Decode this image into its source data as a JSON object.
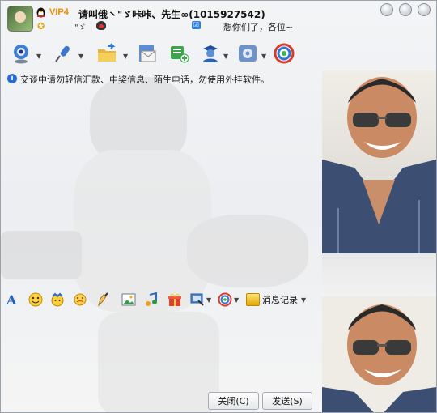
{
  "title": {
    "vip": "VIP4",
    "contact_name": "请叫俄丶\"ゞ咔咔、先生∞(1015927542)",
    "line2": "\"ゞ",
    "signature": "想你们了，各位~"
  },
  "toolbar": {
    "items": [
      "video-call",
      "voice-call",
      "send-file",
      "send-sms",
      "create-discussion",
      "apps",
      "settings",
      "soso"
    ]
  },
  "notice": {
    "text": "交谈中请勿轻信汇款、中奖信息、陌生电话，勿使用外挂软件。"
  },
  "format_bar": {
    "message_record": "消息记录"
  },
  "buttons": {
    "close": "关闭(C)",
    "send": "发送(S)"
  },
  "colors": {
    "vip": "#f08a00",
    "info": "#2a6ad6",
    "window_bg": "#eceef1"
  }
}
